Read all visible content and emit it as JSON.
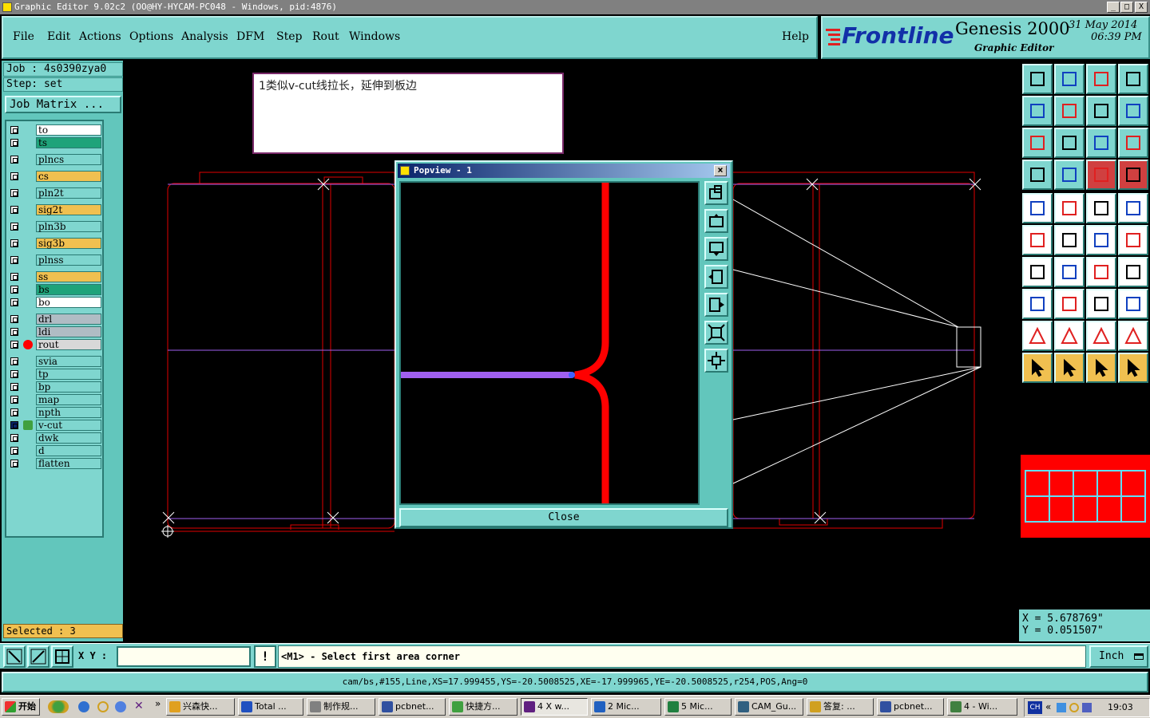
{
  "window": {
    "title": "Graphic Editor 9.02c2 (OO@HY-HYCAM-PC048 - Windows, pid:4876)",
    "controls": [
      "_",
      "□",
      "X"
    ]
  },
  "menu": {
    "items": [
      "File",
      "Edit",
      "Actions",
      "Options",
      "Analysis",
      "DFM",
      "Step",
      "Rout",
      "Windows"
    ],
    "help": "Help"
  },
  "brand": {
    "logo": "Frontline",
    "product": "Genesis 2000",
    "subtitle": "Graphic Editor",
    "date": "31 May 2014",
    "time": "06:39 PM"
  },
  "job": {
    "job_line": "Job : 4s0390zya0",
    "step_line": "Step: set",
    "matrix_button": "Job Matrix ..."
  },
  "layers": [
    {
      "name": "to",
      "color": "#ffffff"
    },
    {
      "name": "ts",
      "color": "#1fa37a"
    },
    {
      "name": "plncs",
      "color": "#7fd6cf"
    },
    {
      "name": "cs",
      "color": "#f0c050"
    },
    {
      "name": "pln2t",
      "color": "#7fd6cf"
    },
    {
      "name": "sig2t",
      "color": "#f0c050"
    },
    {
      "name": "pln3b",
      "color": "#7fd6cf"
    },
    {
      "name": "sig3b",
      "color": "#f0c050"
    },
    {
      "name": "plnss",
      "color": "#7fd6cf"
    },
    {
      "name": "ss",
      "color": "#f0c050"
    },
    {
      "name": "bs",
      "color": "#1fa37a"
    },
    {
      "name": "bo",
      "color": "#ffffff"
    },
    {
      "name": "drl",
      "color": "#b0bcc4"
    },
    {
      "name": "ldi",
      "color": "#b0bcc4"
    },
    {
      "name": "rout",
      "color": "#d8d8d8"
    },
    {
      "name": "svia",
      "color": "#7fd6cf"
    },
    {
      "name": "tp",
      "color": "#7fd6cf"
    },
    {
      "name": "bp",
      "color": "#7fd6cf"
    },
    {
      "name": "map",
      "color": "#7fd6cf"
    },
    {
      "name": "npth",
      "color": "#7fd6cf"
    },
    {
      "name": "v-cut",
      "color": "#7fd6cf"
    },
    {
      "name": "dwk",
      "color": "#7fd6cf"
    },
    {
      "name": "d",
      "color": "#7fd6cf"
    },
    {
      "name": "flatten",
      "color": "#7fd6cf"
    }
  ],
  "selected": "Selected : 3",
  "note": "1类似v-cut线拉长，延伸到板边",
  "popview": {
    "title": "Popview - 1",
    "close_label": "Close"
  },
  "coords": {
    "x": "X = 5.678769\"",
    "y": "Y = 0.051507\""
  },
  "status": {
    "xy_label": "X Y :",
    "xy_value": "",
    "prompt": "<M1> - Select first area corner",
    "units": "Inch"
  },
  "info_line": "cam/bs,#155,Line,XS=17.999455,YS=-20.5008525,XE=-17.999965,YE=-20.5008525,r254,POS,Ang=0",
  "taskbar": {
    "start": "开始",
    "tasks": [
      "兴森快...",
      "Total ...",
      "制作规...",
      "pcbnet...",
      "快捷方...",
      "4 X w...",
      "2 Mic...",
      "5 Mic...",
      "CAM_Gu...",
      "答复: ...",
      "pcbnet...",
      "4 - Wi..."
    ],
    "lang": "CH",
    "clock": "19:03"
  },
  "colors": {
    "panel": "#7fd6cf",
    "accent_red": "#ff0000",
    "vcut_purple": "#a060f0"
  }
}
